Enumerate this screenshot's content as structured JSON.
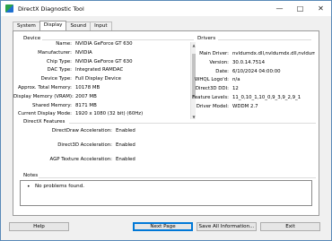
{
  "window": {
    "title": "DirectX Diagnostic Tool"
  },
  "tabs": [
    {
      "label": "System"
    },
    {
      "label": "Display"
    },
    {
      "label": "Sound"
    },
    {
      "label": "Input"
    }
  ],
  "device": {
    "title": "Device",
    "rows": [
      {
        "label": "Name:",
        "value": "NVIDIA GeForce GT 630"
      },
      {
        "label": "Manufacturer:",
        "value": "NVIDIA"
      },
      {
        "label": "Chip Type:",
        "value": "NVIDIA GeForce GT 630"
      },
      {
        "label": "DAC Type:",
        "value": "Integrated RAMDAC"
      },
      {
        "label": "Device Type:",
        "value": "Full Display Device"
      },
      {
        "label": "Approx. Total Memory:",
        "value": "10178 MB"
      },
      {
        "label": "Display Memory (VRAM):",
        "value": "2007 MB"
      },
      {
        "label": "Shared Memory:",
        "value": "8171 MB"
      },
      {
        "label": "Current Display Mode:",
        "value": "1920 x 1080 (32 bit) (60Hz)"
      }
    ]
  },
  "drivers": {
    "title": "Drivers",
    "rows": [
      {
        "label": "Main Driver:",
        "value": "nvldumdx.dll,nvldumdx.dll,nvldumdx.c"
      },
      {
        "label": "Version:",
        "value": "30.0.14.7514"
      },
      {
        "label": "Date:",
        "value": "6/10/2024 04:00:00"
      },
      {
        "label": "WHQL Logo'd:",
        "value": "n/a"
      },
      {
        "label": "Direct3D DDI:",
        "value": "12"
      },
      {
        "label": "Feature Levels:",
        "value": "11_0,10_1,10_0,9_3,9_2,9_1"
      },
      {
        "label": "Driver Model:",
        "value": "WDDM 2.7"
      }
    ]
  },
  "features": {
    "title": "DirectX Features",
    "rows": [
      {
        "label": "DirectDraw Acceleration:",
        "value": "Enabled"
      },
      {
        "label": "Direct3D Acceleration:",
        "value": "Enabled"
      },
      {
        "label": "AGP Texture Acceleration:",
        "value": "Enabled"
      }
    ]
  },
  "notes": {
    "title": "Notes",
    "bullet": "•",
    "text": "No problems found."
  },
  "buttons": {
    "help": "Help",
    "next_page": "Next Page",
    "save_all": "Save All Information...",
    "exit": "Exit"
  }
}
